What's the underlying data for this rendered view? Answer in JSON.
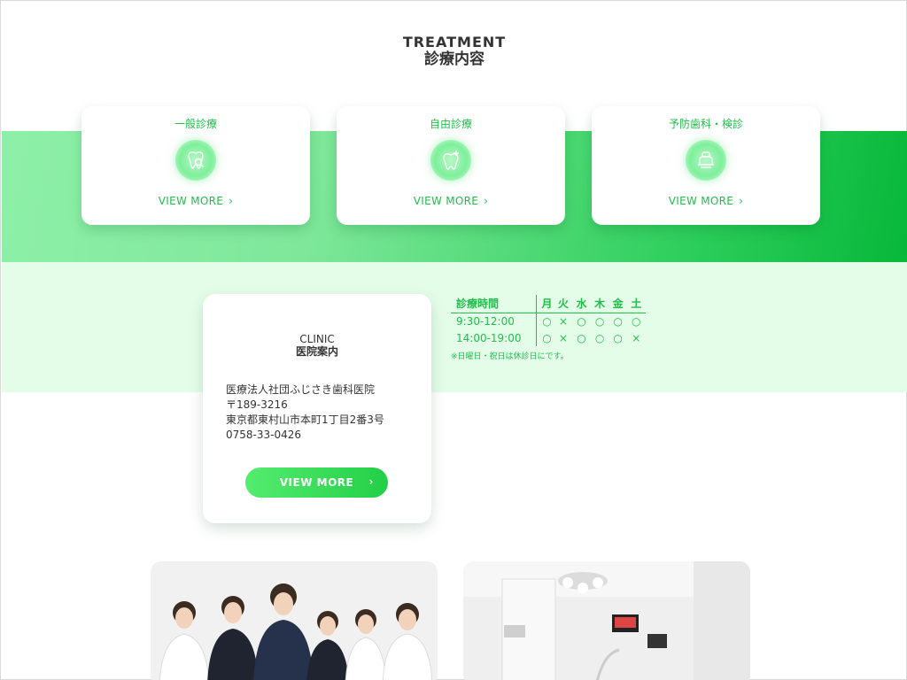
{
  "treatment": {
    "title_en": "TREATMENT",
    "title_jp": "診療内容",
    "cards": [
      {
        "label": "一般診療",
        "more": "VIEW MORE",
        "icon": "tooth-magnifier-icon"
      },
      {
        "label": "自由診療",
        "more": "VIEW MORE",
        "icon": "tooth-implant-icon"
      },
      {
        "label": "予防歯科・検診",
        "more": "VIEW MORE",
        "icon": "dental-chair-icon"
      }
    ]
  },
  "clinic": {
    "title_en": "CLINIC",
    "title_jp": "医院案内",
    "name": "医療法人社団ふじさき歯科医院",
    "postal": "〒189-3216",
    "address": "東京都東村山市本町1丁目2番3号",
    "phone": "0758-33-0426",
    "button": "VIEW MORE"
  },
  "hours": {
    "header_label": "診療時間",
    "days": [
      "月",
      "火",
      "水",
      "木",
      "金",
      "土"
    ],
    "rows": [
      {
        "time": "9:30-12:00",
        "marks": [
          "○",
          "×",
          "○",
          "○",
          "○",
          "○"
        ]
      },
      {
        "time": "14:00-19:00",
        "marks": [
          "○",
          "×",
          "○",
          "○",
          "○",
          "×"
        ]
      }
    ],
    "note": "※日曜日・祝日は休診日にです。"
  },
  "colors": {
    "accent": "#1fbf4a",
    "band_start": "#8ef0a8",
    "band_end": "#07b83a",
    "mint": "#e4fde9"
  }
}
